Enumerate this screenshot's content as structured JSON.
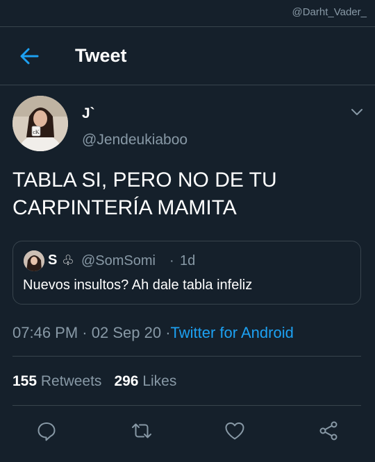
{
  "watermark": "@Darht_Vader_",
  "header": {
    "title": "Tweet"
  },
  "tweet": {
    "display_name": "J`",
    "handle": "@Jendeukiaboo",
    "text": "TABLA SI, PERO NO DE TU\nCARPINTERÍA MAMITA",
    "time": "07:46 PM",
    "date": "02 Sep 20",
    "source": "Twitter for Android",
    "sep": "·"
  },
  "quote": {
    "name": "S",
    "club": "♧",
    "handle": "@SomSomi",
    "dot": "·",
    "time": "1d",
    "text": "Nuevos insultos? Ah dale tabla infeliz"
  },
  "stats": {
    "retweets_count": "155",
    "retweets_label": "Retweets",
    "likes_count": "296",
    "likes_label": "Likes"
  },
  "colors": {
    "background": "#15202b",
    "accent": "#1da1f2",
    "muted": "#8899a6",
    "divider": "#38444d"
  },
  "icons": [
    "back-arrow-icon",
    "chevron-down-icon",
    "reply-icon",
    "retweet-icon",
    "like-icon",
    "share-icon"
  ]
}
